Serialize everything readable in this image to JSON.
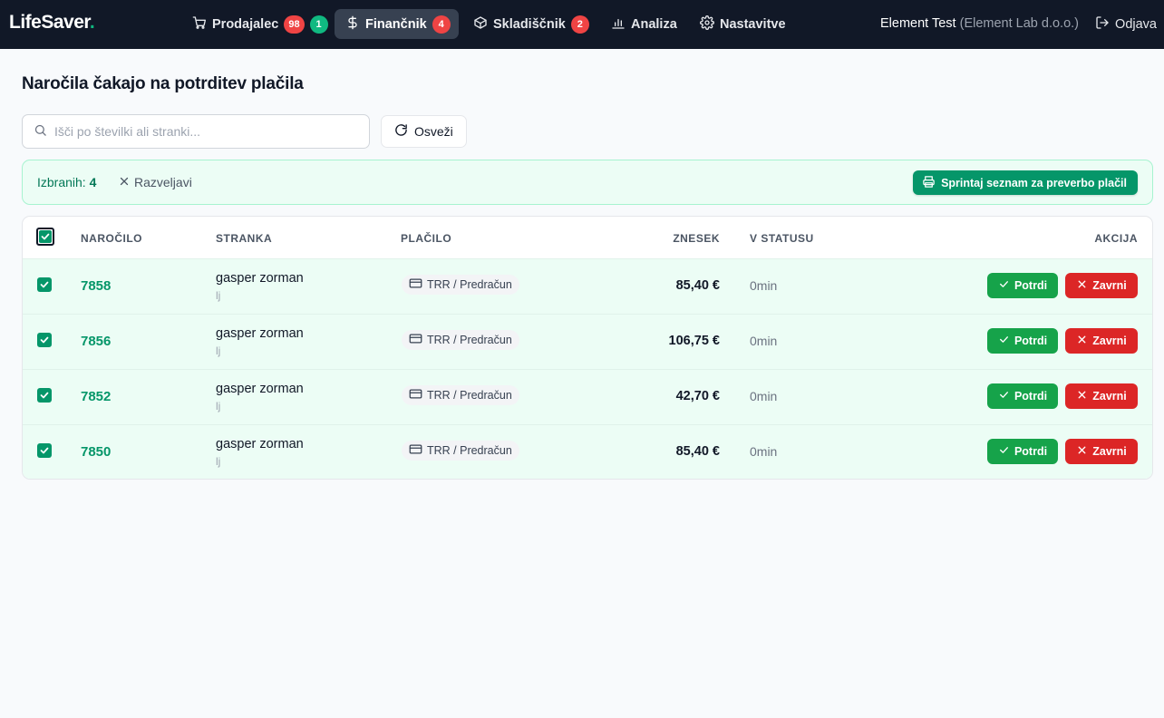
{
  "nav": {
    "logo": "LifeSaver",
    "logo_dot": ".",
    "items": [
      {
        "label": "Prodajalec",
        "icon": "cart-icon",
        "badges": [
          "98",
          "1"
        ]
      },
      {
        "label": "Finančnik",
        "icon": "dollar-icon",
        "badges": [
          "4"
        ]
      },
      {
        "label": "Skladiščnik",
        "icon": "box-icon",
        "badges": [
          "2"
        ]
      },
      {
        "label": "Analiza",
        "icon": "bar-chart-icon",
        "badges": []
      },
      {
        "label": "Nastavitve",
        "icon": "gear-icon",
        "badges": []
      }
    ],
    "user_name": "Element Test",
    "user_org": "(Element Lab d.o.o.)",
    "logout": "Odjava"
  },
  "page": {
    "title": "Naročila čakajo na potrditev plačila"
  },
  "toolbar": {
    "search_placeholder": "Išči po številki ali stranki...",
    "refresh_label": "Osveži"
  },
  "selection": {
    "label": "Izbranih:",
    "count": "4",
    "deselect_label": "Razveljavi",
    "print_label": "Sprintaj seznam za preverbo plačil"
  },
  "table": {
    "headers": {
      "order": "NAROČILO",
      "customer": "STRANKA",
      "payment": "PLAČILO",
      "amount": "ZNESEK",
      "status": "V STATUSU",
      "action": "AKCIJA"
    },
    "confirm_label": "Potrdi",
    "reject_label": "Zavrni",
    "rows": [
      {
        "order": "7858",
        "customer": "gasper zorman",
        "city": "lj",
        "payment": "TRR / Predračun",
        "amount": "85,40 €",
        "status": "0min"
      },
      {
        "order": "7856",
        "customer": "gasper zorman",
        "city": "lj",
        "payment": "TRR / Predračun",
        "amount": "106,75 €",
        "status": "0min"
      },
      {
        "order": "7852",
        "customer": "gasper zorman",
        "city": "lj",
        "payment": "TRR / Predračun",
        "amount": "42,70 €",
        "status": "0min"
      },
      {
        "order": "7850",
        "customer": "gasper zorman",
        "city": "lj",
        "payment": "TRR / Predračun",
        "amount": "85,40 €",
        "status": "0min"
      }
    ]
  },
  "colors": {
    "nav_bg": "#111827",
    "accent_green": "#059669",
    "confirm": "#16a34a",
    "reject": "#dc2626",
    "badge_red": "#ef4444",
    "badge_green": "#10b981"
  }
}
